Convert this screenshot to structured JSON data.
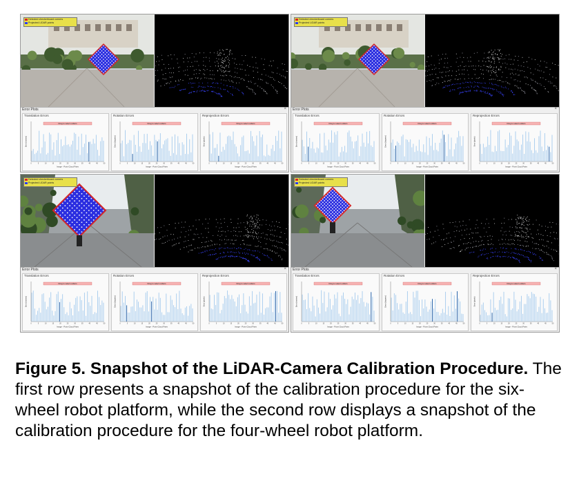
{
  "panels": [
    {
      "id": "tl",
      "scene": "hall",
      "board": "small"
    },
    {
      "id": "tr",
      "scene": "hall",
      "board": "small"
    },
    {
      "id": "bl",
      "scene": "corridor",
      "board": "large"
    },
    {
      "id": "br",
      "scene": "corridor",
      "board": "large"
    }
  ],
  "error_window": {
    "title": "Error Plots",
    "close_icon": "×",
    "subplots": [
      {
        "title": "Translation Errors",
        "ylabel": "Error (meters)",
        "drag_label": "Drag to select outliers",
        "xlabel": "Image - Point Cloud Pairs"
      },
      {
        "title": "Rotation Errors",
        "ylabel": "Error (degrees)",
        "drag_label": "Drag to select outliers",
        "xlabel": "Image - Point Cloud Pairs"
      },
      {
        "title": "Reprojection Errors",
        "ylabel": "Error (pixels)",
        "drag_label": "Drag to select outliers",
        "xlabel": "Image - Point Cloud Pairs"
      }
    ]
  },
  "legend": {
    "line1": "Detected checkerboard corners",
    "line2": "Projected LiDAR points"
  },
  "caption": {
    "bold": "Figure 5.  Snapshot of the LiDAR-Camera Calibration Procedure.",
    "text": " The first row presents a snapshot of the calibration procedure for the six-wheel robot platform, while the second row displays a snapshot of the calibration procedure for the four-wheel robot platform."
  },
  "colors": {
    "bar": "#a8cdee",
    "bar_selected": "#1f5ea8",
    "drag_bar": "#f6b3b3",
    "lidar_points": "#2a3bff",
    "board": "#2b2ee0"
  }
}
